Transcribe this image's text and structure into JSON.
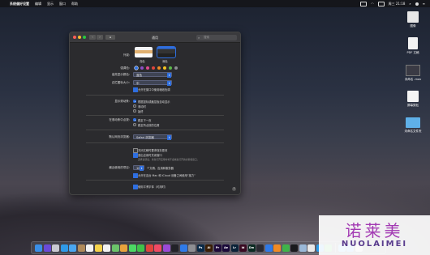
{
  "menubar": {
    "apple": "",
    "items": [
      "系统偏好设置",
      "编辑",
      "显示",
      "窗口",
      "帮助"
    ],
    "clock": "周三 21:18"
  },
  "desktop": {
    "items": [
      {
        "label": "图像",
        "color": "#e8e8e8"
      },
      {
        "label": "PDF 文稿",
        "color": "#f2f2f2"
      },
      {
        "label": "未命名 .mov",
        "color": "#3a3a44"
      },
      {
        "label": "屏幕剪贴",
        "color": "#f4f4f4"
      },
      {
        "label": "未命名文件夹",
        "color": "#5fb0e8"
      }
    ]
  },
  "window": {
    "title": "通用",
    "search_placeholder": "搜索",
    "grid_label": "⊞",
    "appearance": {
      "label": "外观:",
      "options": [
        {
          "name": "浅色",
          "selected": false
        },
        {
          "name": "深色",
          "selected": true
        }
      ]
    },
    "accent": {
      "label": "强调色:",
      "colors": [
        "#2f6fe0",
        "#8e4ec6",
        "#e04b8f",
        "#e0463e",
        "#f08a24",
        "#f5c420",
        "#5bb84a",
        "#8e8e93"
      ]
    },
    "highlight": {
      "label": "高亮显示颜色:",
      "value": "蓝色"
    },
    "sidebar_icon": {
      "label": "边栏图标大小:",
      "value": "中"
    },
    "wallpaper_tint": {
      "label": "允许在窗口中使用墙纸色调",
      "checked": true
    },
    "scrollbars": {
      "label": "显示滚动条:",
      "options": [
        {
          "text": "根据鼠标或触控板自动显示",
          "selected": true
        },
        {
          "text": "滚动时",
          "selected": false
        },
        {
          "text": "始终",
          "selected": false
        }
      ]
    },
    "click_scrollbar": {
      "label": "在滚动条中点按:",
      "options": [
        {
          "text": "跳至下一页",
          "selected": true
        },
        {
          "text": "跳至所点按的位置",
          "selected": false
        }
      ]
    },
    "browser": {
      "label": "默认网页浏览器:",
      "value": "Safari 浏览器"
    },
    "docs": {
      "opt1": {
        "text": "关闭文稿时要求保存更改",
        "checked": false
      },
      "opt2": {
        "text": "退出应用时关闭窗口",
        "checked": true
      },
      "note": "选择此项后，重新打开应用时将不会恢复打开的文稿和窗口。"
    },
    "recent": {
      "label": "最近使用的项目:",
      "value": "10",
      "suffix": "个文稿、应用和服务器"
    },
    "handoff": {
      "text": "允许在这台 Mac 和 iCloud 设备之间使用“接力”",
      "checked": true
    },
    "lcd": {
      "text": "使用平滑字体（可用时）",
      "checked": true
    },
    "help": "?"
  },
  "dock": {
    "apps": [
      {
        "name": "finder",
        "color": "#3a8fe8",
        "glyph": ""
      },
      {
        "name": "siri",
        "color": "#6a4ad8",
        "glyph": ""
      },
      {
        "name": "launchpad",
        "color": "#c9c9d1",
        "glyph": ""
      },
      {
        "name": "safari",
        "color": "#2f9ae8",
        "glyph": ""
      },
      {
        "name": "mail",
        "color": "#4aa6f0",
        "glyph": ""
      },
      {
        "name": "contacts",
        "color": "#b08a5a",
        "glyph": ""
      },
      {
        "name": "calendar",
        "color": "#f2f2f2",
        "glyph": ""
      },
      {
        "name": "notes",
        "color": "#f5d24a",
        "glyph": ""
      },
      {
        "name": "reminders",
        "color": "#f2f2f2",
        "glyph": ""
      },
      {
        "name": "maps",
        "color": "#6cc36a",
        "glyph": ""
      },
      {
        "name": "photos",
        "color": "#e8a23c",
        "glyph": ""
      },
      {
        "name": "messages",
        "color": "#4cd964",
        "glyph": ""
      },
      {
        "name": "facetime",
        "color": "#3fc24a",
        "glyph": ""
      },
      {
        "name": "news",
        "color": "#e0443c",
        "glyph": ""
      },
      {
        "name": "music",
        "color": "#f04a64",
        "glyph": ""
      },
      {
        "name": "podcasts",
        "color": "#9a4ad8",
        "glyph": ""
      },
      {
        "name": "tv",
        "color": "#222228",
        "glyph": ""
      },
      {
        "name": "app-store",
        "color": "#2f7ae8",
        "glyph": ""
      },
      {
        "name": "system-preferences",
        "color": "#8e8e93",
        "glyph": ""
      },
      {
        "name": "photoshop",
        "color": "#0a2a48",
        "glyph": "Ps"
      },
      {
        "name": "illustrator",
        "color": "#3a1e06",
        "glyph": "Ai"
      },
      {
        "name": "premiere",
        "color": "#1e0a3a",
        "glyph": "Pr"
      },
      {
        "name": "after-effects",
        "color": "#1a0a3a",
        "glyph": "Ae"
      },
      {
        "name": "lightroom",
        "color": "#0a2238",
        "glyph": "Lr"
      },
      {
        "name": "indesign",
        "color": "#3a0a22",
        "glyph": "Id"
      },
      {
        "name": "dreamweaver",
        "color": "#0a2a22",
        "glyph": "Dw"
      },
      {
        "name": "finalcut",
        "color": "#2a2a32",
        "glyph": ""
      },
      {
        "name": "keynote",
        "color": "#2f7ae8",
        "glyph": ""
      },
      {
        "name": "pages",
        "color": "#f08a24",
        "glyph": ""
      },
      {
        "name": "numbers",
        "color": "#3fb44a",
        "glyph": ""
      },
      {
        "name": "terminal",
        "color": "#1a1a1e",
        "glyph": ""
      },
      {
        "name": "preview",
        "color": "#9ab8d8",
        "glyph": ""
      },
      {
        "name": "chrome",
        "color": "#e8e8e8",
        "glyph": ""
      },
      {
        "name": "qq",
        "color": "#2a9ae8",
        "glyph": ""
      },
      {
        "name": "wechat",
        "color": "#3fc24a",
        "glyph": ""
      },
      {
        "name": "folder",
        "color": "#5fb0e8",
        "glyph": ""
      },
      {
        "name": "downloads",
        "color": "#4a9ae8",
        "glyph": ""
      },
      {
        "name": "trash",
        "color": "#b8b8c0",
        "glyph": ""
      }
    ]
  },
  "watermark": {
    "cn": "诺莱美",
    "en": "NUOLAIMEI"
  }
}
